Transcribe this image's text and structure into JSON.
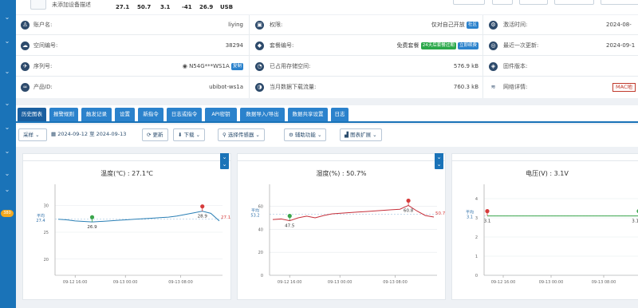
{
  "sidebar": {
    "badge": "380"
  },
  "header": {
    "device_desc": "未添加设备描述",
    "stats": [
      "27.1",
      "50.7",
      "3.1",
      "-41",
      "26.9",
      "USB"
    ]
  },
  "info": {
    "rows": [
      {
        "c1": {
          "label": "账户名:",
          "value": "liying"
        },
        "c2": {
          "label": "权限:",
          "value": "仅对自己开放",
          "tag": "社区"
        },
        "c3": {
          "label": "激活时间:",
          "value": "2024-08-"
        }
      },
      {
        "c1": {
          "label": "空间编号:",
          "value": "38294"
        },
        "c2": {
          "label": "套餐编号:",
          "value": "免费套餐",
          "tag": "24天后套餐过期",
          "tag2": "立即续费"
        },
        "c3": {
          "label": "最近一次更新:",
          "value": "2024-09-1"
        }
      },
      {
        "c1": {
          "label": "序列号:",
          "value": "N54G***WS1A",
          "tag": "复制"
        },
        "c2": {
          "label": "已占用存储空间:",
          "value": "576.9 kB"
        },
        "c3": {
          "label": "固件版本:",
          "value": ""
        }
      },
      {
        "c1": {
          "label": "产品ID:",
          "value": "ubibot-ws1a"
        },
        "c2": {
          "label": "当月数据下载流量:",
          "value": "760.3 kB"
        },
        "c3": {
          "label": "网络详情:",
          "value": "MAC地"
        }
      }
    ]
  },
  "tabs": [
    "历史图表",
    "报警规则",
    "触发记录",
    "设置",
    "新指令",
    "日志或指令",
    "API密钥",
    "数据导入/导出",
    "数据共享设置",
    "日志"
  ],
  "toolbar": {
    "sample": "采样",
    "date_range": "2024-09-12 至 2024-09-13",
    "refresh": "更新",
    "download": "下载",
    "select_sensor": "选择传感器",
    "aux": "辅助功能",
    "chart_ext": "图表扩展"
  },
  "colors": {
    "primary": "#1a73b8",
    "tab": "#2b82cc",
    "temp_line": "#2a7fb5",
    "hum_line": "#c62f3a",
    "volt_line": "#3aa54b"
  },
  "chart_data": [
    {
      "type": "line",
      "title": "温度(℃) : 27.1℃",
      "x": [
        "09-12 16:00",
        "09-13 00:00",
        "09-13 08:00"
      ],
      "yticks": [
        "20",
        "25",
        "30"
      ],
      "ylim": [
        17,
        33
      ],
      "avg_label": "平均",
      "avg_value": "27.4",
      "min_value": "26.9",
      "max_value": "28.9",
      "last_value": "27.1",
      "series": [
        {
          "values": [
            27.4,
            27.3,
            27.1,
            27.0,
            26.9,
            27.0,
            27.1,
            27.2,
            27.3,
            27.4,
            27.5,
            27.6,
            27.7,
            27.8,
            28.0,
            28.3,
            28.6,
            28.9,
            28.5,
            27.1
          ]
        }
      ]
    },
    {
      "type": "line",
      "title": "湿度(%) : 50.7%",
      "x": [
        "09-12 16:00",
        "09-13 00:00",
        "09-13 08:00"
      ],
      "yticks": [
        "0",
        "20",
        "40",
        "60"
      ],
      "ylim": [
        0,
        75
      ],
      "avg_label": "平均",
      "avg_value": "53.2",
      "min_value": "47.5",
      "max_value": "60.8",
      "last_value": "50.7",
      "series": [
        {
          "values": [
            48.5,
            49.0,
            47.5,
            50.0,
            51.5,
            50.0,
            52.0,
            53.5,
            54.0,
            54.5,
            55.0,
            55.5,
            56.0,
            56.5,
            57.0,
            57.5,
            60.8,
            56.0,
            52.0,
            50.7
          ]
        }
      ]
    },
    {
      "type": "line",
      "title": "电压(V) : 3.1V",
      "x": [
        "09-12 16:00",
        "09-13 00:00",
        "09-13 08:00"
      ],
      "yticks": [
        "0",
        "1",
        "2",
        "3",
        "4"
      ],
      "ylim": [
        0,
        4.5
      ],
      "avg_label": "平均",
      "avg_value": "3.1",
      "max_value": "3.1",
      "last_value": "3.1",
      "series": [
        {
          "values": [
            3.1,
            3.1,
            3.1,
            3.1,
            3.1,
            3.1,
            3.1,
            3.1,
            3.1,
            3.1,
            3.1,
            3.1,
            3.1,
            3.1,
            3.1,
            3.1,
            3.1,
            3.1,
            3.1,
            3.1
          ]
        }
      ]
    }
  ]
}
